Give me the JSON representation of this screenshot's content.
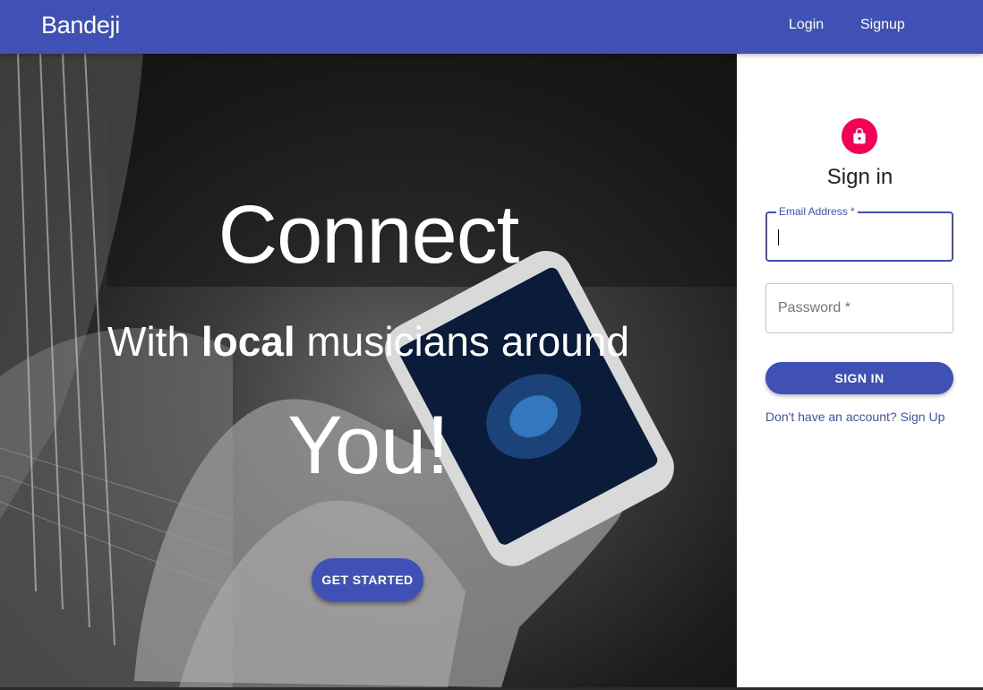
{
  "appbar": {
    "brand": "Bandeji",
    "links": {
      "login": "Login",
      "signup": "Signup"
    },
    "color": "#3f51b5"
  },
  "hero": {
    "title": "Connect",
    "subtitle_prefix": "With ",
    "subtitle_bold": "local",
    "subtitle_suffix": " musicians around",
    "emphasis": "You!",
    "cta_label": "GET STARTED"
  },
  "signin": {
    "icon": "lock-icon",
    "title": "Sign in",
    "email_label": "Email Address *",
    "password_label": "Password *",
    "submit_label": "SIGN IN",
    "signup_prompt": "Don't have an account? Sign Up",
    "accent": "#f50057"
  }
}
